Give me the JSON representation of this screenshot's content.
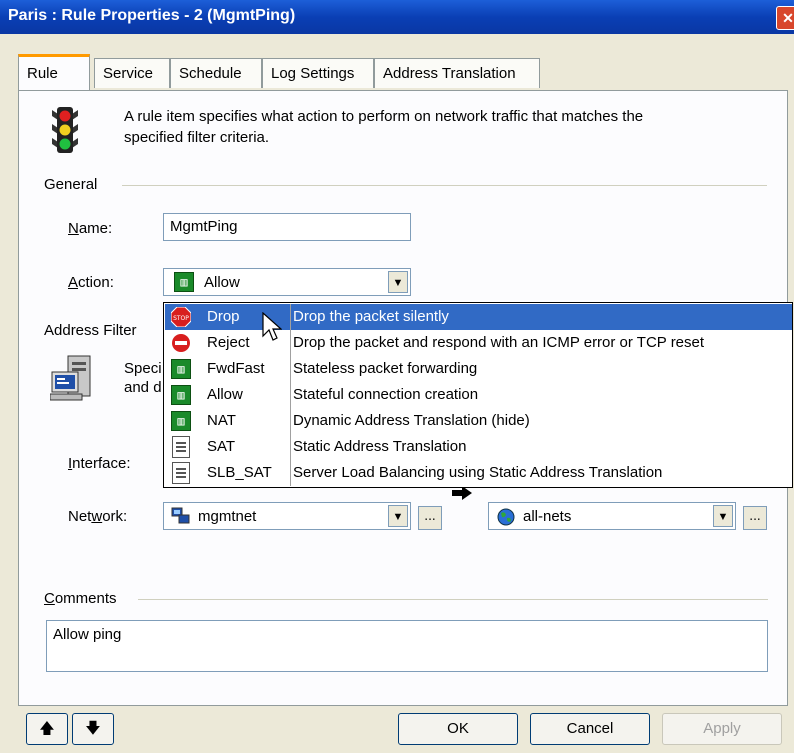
{
  "window": {
    "title": "Paris : Rule Properties - 2 (MgmtPing)",
    "close_glyph": "✕"
  },
  "tabs": [
    {
      "label": "Rule",
      "active": true
    },
    {
      "label": "Service",
      "active": false
    },
    {
      "label": "Schedule",
      "active": false
    },
    {
      "label": "Log Settings",
      "active": false
    },
    {
      "label": "Address Translation",
      "active": false
    }
  ],
  "rule": {
    "description_line1": "A rule item specifies what action to perform on network traffic that matches the",
    "description_line2": "specified filter criteria.",
    "icon": "traffic-light-icon"
  },
  "general": {
    "heading": "General",
    "name_label": "Name:",
    "name_value": "MgmtPing",
    "action_label": "Action:",
    "action_value": "Allow"
  },
  "action_options": [
    {
      "name": "Drop",
      "description": "Drop the packet silently",
      "icon": "stop-icon",
      "selected": true
    },
    {
      "name": "Reject",
      "description": "Drop the packet and respond with an ICMP error or TCP reset",
      "icon": "no-entry-icon",
      "selected": false
    },
    {
      "name": "FwdFast",
      "description": "Stateless packet forwarding",
      "icon": "green-grid-icon",
      "selected": false
    },
    {
      "name": "Allow",
      "description": "Stateful connection creation",
      "icon": "green-grid-icon",
      "selected": false
    },
    {
      "name": "NAT",
      "description": "Dynamic Address Translation (hide)",
      "icon": "green-grid-icon",
      "selected": false
    },
    {
      "name": "SAT",
      "description": "Static Address Translation",
      "icon": "document-icon",
      "selected": false
    },
    {
      "name": "SLB_SAT",
      "description": "Server Load Balancing using Static Address Translation",
      "icon": "document-icon",
      "selected": false
    }
  ],
  "address_filter": {
    "heading": "Address Filter",
    "desc_partial_1": "Speci",
    "desc_partial_2": "and d",
    "interface_label": "Interface:",
    "network_label": "Network:",
    "source_network": "mgmtnet",
    "destination_network": "all-nets",
    "browse_label": "..."
  },
  "comments": {
    "heading": "Comments",
    "value": "Allow ping"
  },
  "buttons": {
    "up": "🡅",
    "down": "🡇",
    "ok": "OK",
    "cancel": "Cancel",
    "apply": "Apply"
  },
  "colors": {
    "title_bar": "#0a3fb5",
    "selection": "#316ac5",
    "dialog_bg": "#ece9d8",
    "tab_highlight": "#ff9a00"
  }
}
